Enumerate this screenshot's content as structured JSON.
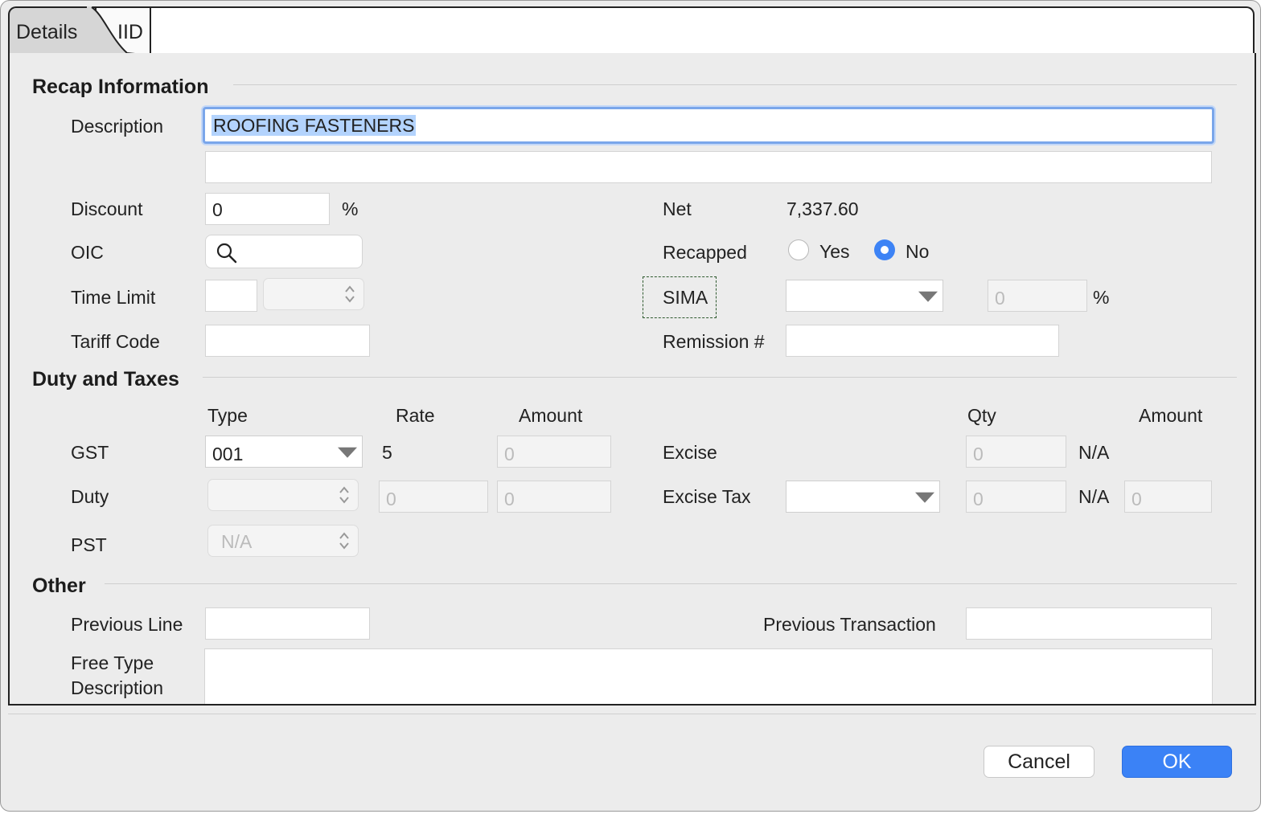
{
  "tabs": {
    "details": "Details",
    "iid": "IID"
  },
  "recap": {
    "title": "Recap Information",
    "description_label": "Description",
    "description_value": "ROOFING FASTENERS",
    "description_value2": "",
    "discount_label": "Discount",
    "discount_value": "0",
    "discount_unit": "%",
    "oic_label": "OIC",
    "time_limit_label": "Time Limit",
    "tariff_code_label": "Tariff Code",
    "net_label": "Net",
    "net_value": "7,337.60",
    "recapped_label": "Recapped",
    "recapped_yes": "Yes",
    "recapped_no": "No",
    "recapped_selected": "No",
    "sima_label": "SIMA",
    "sima_percent_placeholder": "0",
    "sima_unit": "%",
    "remission_label": "Remission #"
  },
  "duty": {
    "title": "Duty and Taxes",
    "col_type": "Type",
    "col_rate": "Rate",
    "col_amount": "Amount",
    "col_qty": "Qty",
    "col_amount2": "Amount",
    "gst_label": "GST",
    "gst_type": "001",
    "gst_rate": "5",
    "gst_amount_placeholder": "0",
    "duty_label": "Duty",
    "duty_rate_placeholder": "0",
    "duty_amount_placeholder": "0",
    "pst_label": "PST",
    "pst_value": "N/A",
    "excise_label": "Excise",
    "excise_qty_placeholder": "0",
    "excise_na": "N/A",
    "excise_tax_label": "Excise Tax",
    "excise_tax_qty_placeholder": "0",
    "excise_tax_na": "N/A",
    "excise_tax_amount_placeholder": "0"
  },
  "other": {
    "title": "Other",
    "previous_line_label": "Previous Line",
    "previous_transaction_label": "Previous Transaction",
    "free_type_label_1": "Free Type",
    "free_type_label_2": "Description"
  },
  "buttons": {
    "cancel": "Cancel",
    "ok": "OK"
  },
  "colors": {
    "accent": "#3b82f6",
    "focus_ring": "#7aa6ea",
    "selection": "#b3d3fd"
  },
  "icons": {
    "oic": "search-icon",
    "stepper": "chevron-updown-icon",
    "combo": "triangle-down-icon"
  }
}
